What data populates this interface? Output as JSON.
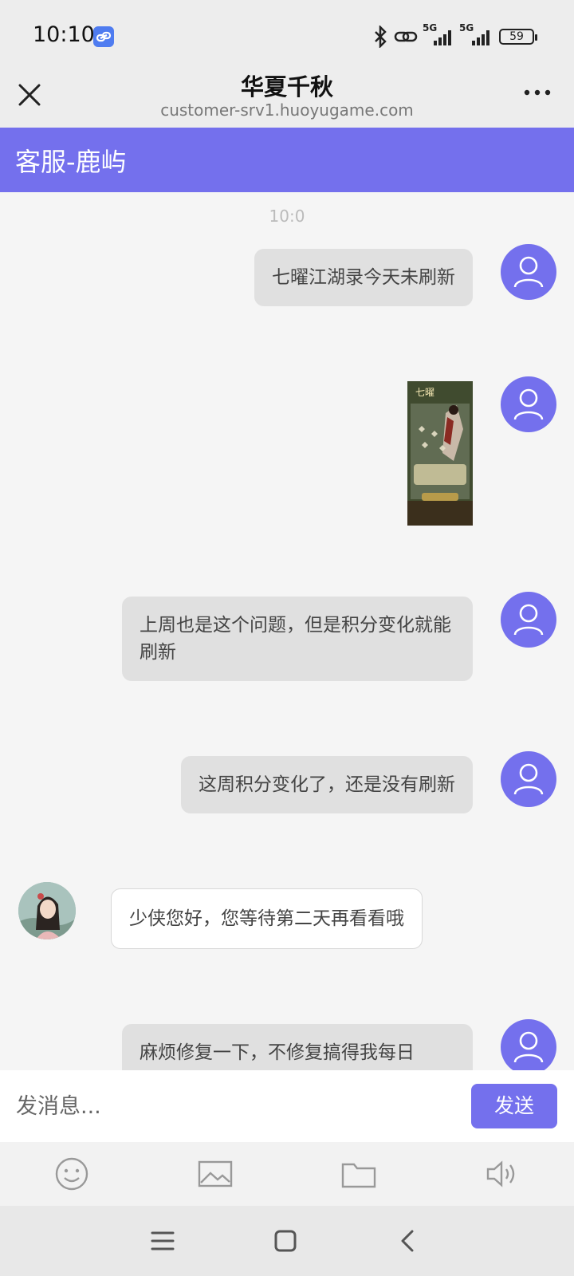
{
  "status_bar": {
    "time": "10:10",
    "signal_1_label": "5G",
    "signal_2_label": "5G",
    "battery": "59"
  },
  "nav": {
    "title": "华夏千秋",
    "url": "customer-srv1.huoyugame.com"
  },
  "agent_header": {
    "name": "客服-鹿屿"
  },
  "chat": {
    "timestamp": "10:0",
    "messages": [
      {
        "from": "user",
        "type": "text",
        "text": "七曜江湖录今天未刷新"
      },
      {
        "from": "user",
        "type": "image"
      },
      {
        "from": "user",
        "type": "text",
        "text": "上周也是这个问题，但是积分变化就能刷新"
      },
      {
        "from": "user",
        "type": "text",
        "text": "这周积分变化了，还是没有刷新"
      },
      {
        "from": "agent",
        "type": "text",
        "text": "少侠您好，您等待第二天再看看哦"
      },
      {
        "from": "user",
        "type": "text",
        "text": "麻烦修复一下，不修复搞得我每日"
      }
    ]
  },
  "composer": {
    "placeholder": "发消息...",
    "send_label": "发送"
  },
  "toolbar": {
    "items": [
      "emoji-icon",
      "image-icon",
      "folder-icon",
      "voice-icon"
    ]
  },
  "colors": {
    "accent": "#7470ed",
    "user_bubble": "#e0e0e0",
    "agent_bubble": "#ffffff"
  }
}
